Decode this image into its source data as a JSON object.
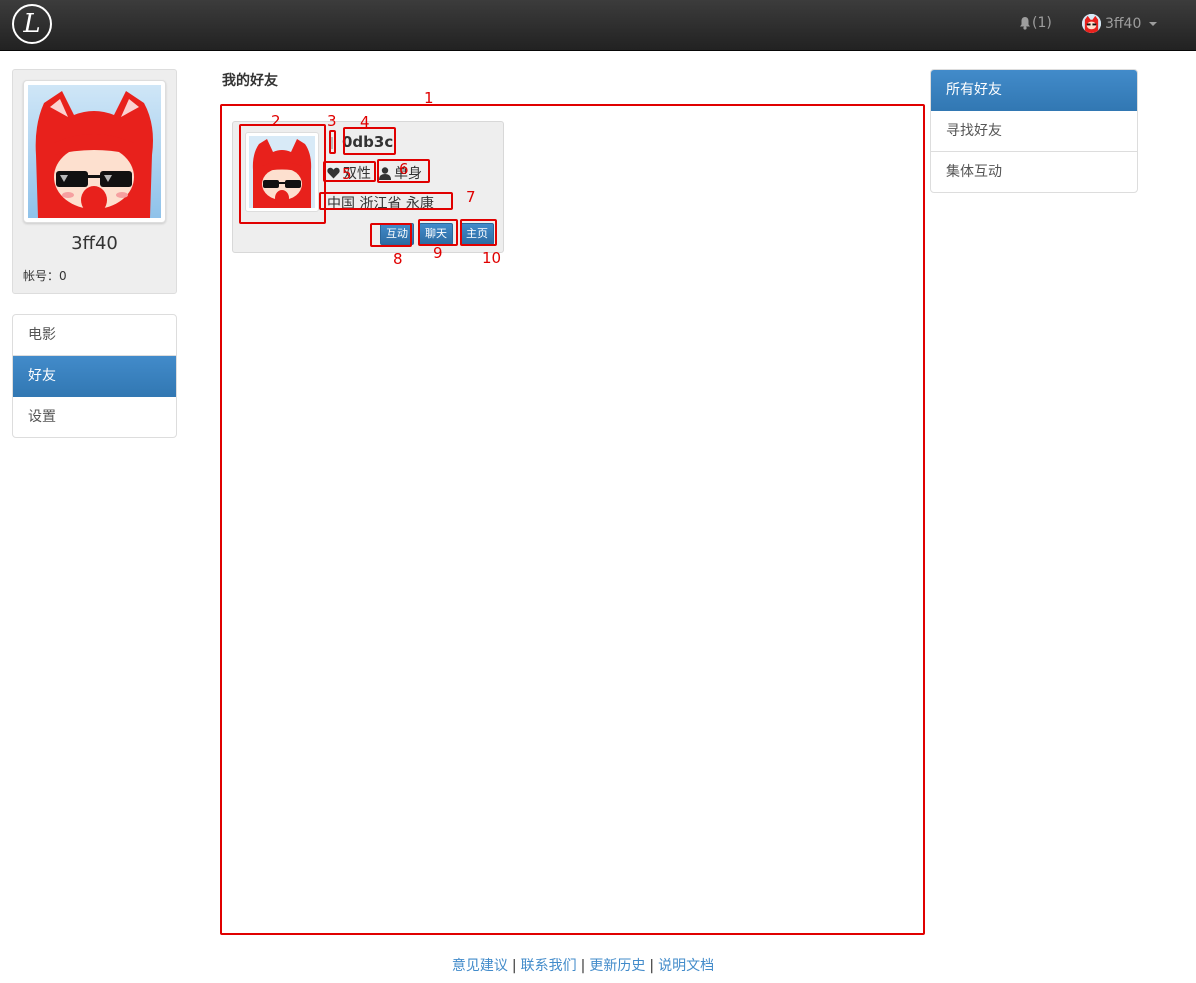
{
  "header": {
    "logo_letter": "L",
    "notification_count": "(1)",
    "username": "3ff40"
  },
  "profile": {
    "name": "3ff40",
    "account_label": "帐号：",
    "account_value": "0"
  },
  "left_nav": {
    "items": [
      {
        "label": "电影",
        "active": false
      },
      {
        "label": "好友",
        "active": true
      },
      {
        "label": "设置",
        "active": false
      }
    ]
  },
  "main": {
    "title": "我的好友",
    "friend": {
      "name": "0db3c",
      "orientation": "双性",
      "status": "单身",
      "location": "中国 浙江省 永康",
      "buttons": {
        "interact": "互动",
        "chat": "聊天",
        "home": "主页"
      }
    }
  },
  "annotations": [
    "1",
    "2",
    "3",
    "4",
    "5",
    "6",
    "7",
    "8",
    "9",
    "10"
  ],
  "right_nav": {
    "items": [
      {
        "label": "所有好友",
        "active": true
      },
      {
        "label": "寻找好友",
        "active": false
      },
      {
        "label": "集体互动",
        "active": false
      }
    ]
  },
  "footer": {
    "links": [
      "意见建议",
      "联系我们",
      "更新历史",
      "说明文档"
    ],
    "separator": "|"
  },
  "colors": {
    "accent": "#428bca",
    "annotation": "#e00000",
    "topbar": "#222222"
  }
}
